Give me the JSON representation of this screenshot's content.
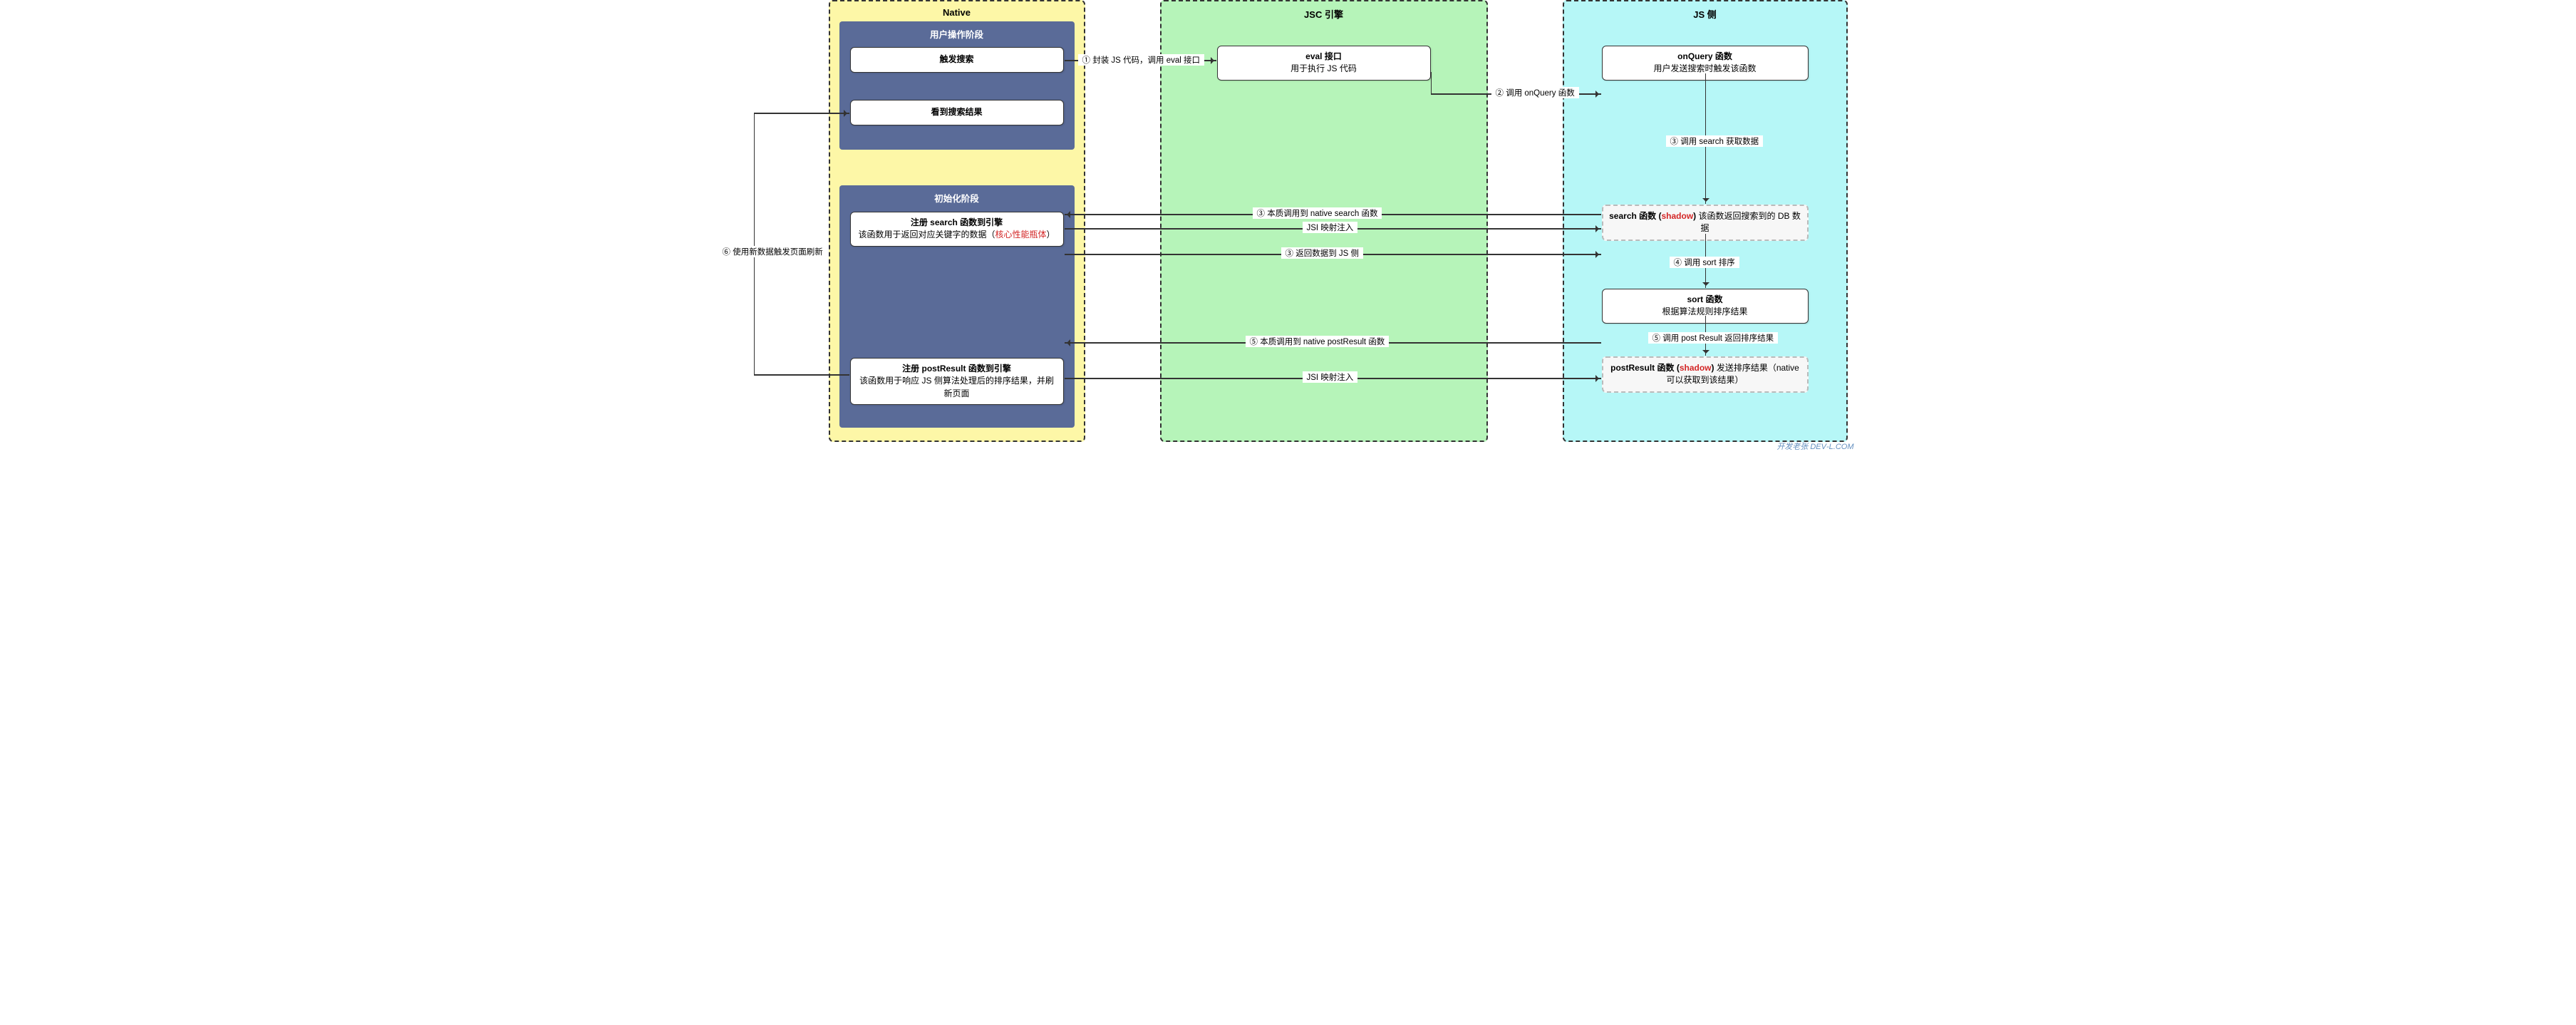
{
  "lanes": {
    "native": "Native",
    "jsc": "JSC 引擎",
    "js": "JS 侧"
  },
  "phases": {
    "user": "用户操作阶段",
    "init": "初始化阶段"
  },
  "nodes": {
    "trigger_search": "触发搜索",
    "see_result": "看到搜索结果",
    "eval_if_title": "eval 接口",
    "eval_if_sub": "用于执行 JS 代码",
    "onquery_title": "onQuery 函数",
    "onquery_sub": "用户发送搜索时触发该函数",
    "reg_search_title": "注册 search 函数到引擎",
    "reg_search_sub_a": "该函数用于返回对应关键字的数据（",
    "reg_search_sub_b": "核心性能瓶体",
    "reg_search_sub_c": "）",
    "search_js_title_a": "search 函数 (",
    "search_js_title_b": "shadow",
    "search_js_title_c": ")",
    "search_js_sub": "该函数返回搜索到的 DB 数据",
    "sort_title": "sort 函数",
    "sort_sub": "根据算法规则排序结果",
    "reg_post_title": "注册 postResult 函数到引擎",
    "reg_post_sub": "该函数用于响应 JS 侧算法处理后的排序结果，并刷新页面",
    "post_js_title_a": "postResult 函数 (",
    "post_js_title_b": "shadow",
    "post_js_title_c": ")",
    "post_js_sub": "发送排序结果（native 可以获取到该结果）"
  },
  "edges": {
    "e1": "① 封装 JS 代码，调用 eval 接口",
    "e2": "② 调用 onQuery 函数",
    "e3a": "③ 本质调用到 native  search 函数",
    "e3b": "③ 返回数据到 JS 侧",
    "e3c": "③ 调用 search 获取数据",
    "e4": "④ 调用 sort 排序",
    "e5a": "⑤ 调用 post Result 返回排序结果",
    "e5b": "⑤ 本质调用到 native postResult 函数",
    "e6": "⑥ 使用新数据触发页面刷新",
    "jsi": "JSI 映射注入"
  },
  "watermark": "开发老张  DEV‑L.COM"
}
